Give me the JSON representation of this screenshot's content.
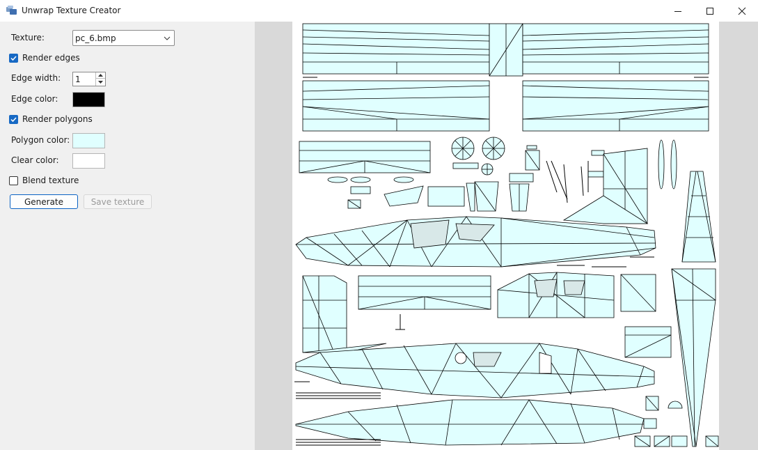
{
  "window": {
    "title": "Unwrap Texture Creator",
    "icon": "app-windows-icon",
    "controls": {
      "minimize": "minimize-icon",
      "maximize": "maximize-icon",
      "close": "close-icon"
    }
  },
  "form": {
    "texture_label": "Texture:",
    "texture_value": "pc_6.bmp",
    "render_edges_label": "Render edges",
    "render_edges_checked": true,
    "edge_width_label": "Edge width:",
    "edge_width_value": "1",
    "edge_color_label": "Edge color:",
    "edge_color": "#000000",
    "render_polygons_label": "Render polygons",
    "render_polygons_checked": true,
    "polygon_color_label": "Polygon color:",
    "polygon_color": "#e0ffff",
    "clear_color_label": "Clear color:",
    "clear_color": "#ffffff",
    "blend_texture_label": "Blend texture",
    "blend_texture_checked": false,
    "generate_label": "Generate",
    "save_label": "Save texture"
  },
  "colors": {
    "accent": "#1769c4",
    "panel_bg": "#f0f0f0",
    "preview_bg": "#d9d9d9",
    "wire_fill": "#e0ffff",
    "wire_edge": "#000000"
  }
}
